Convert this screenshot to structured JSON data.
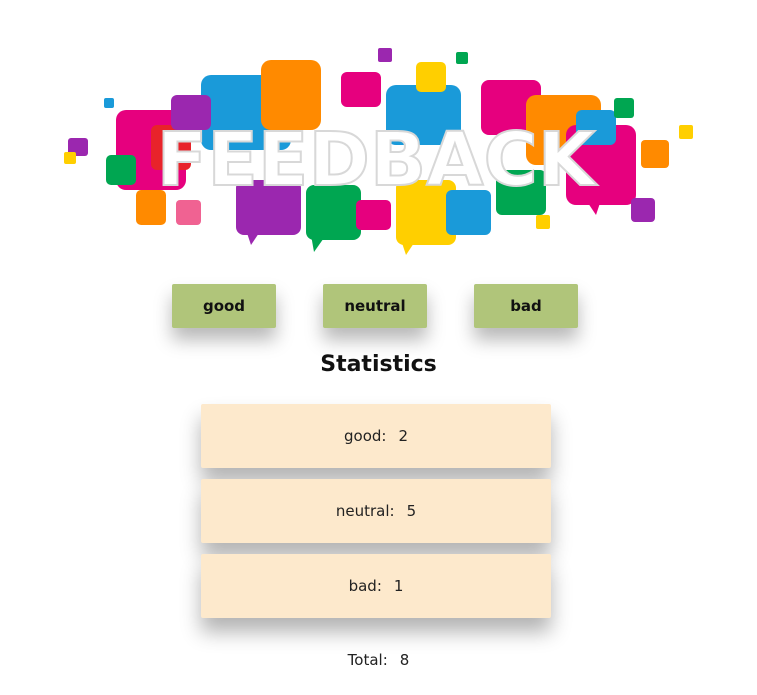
{
  "banner": {
    "text": "FEEDBACK",
    "colors": [
      "#e6007e",
      "#ff8a00",
      "#00a651",
      "#1a9ad9",
      "#ffcf00",
      "#9b27af",
      "#e8232a",
      "#f06292"
    ]
  },
  "buttons": {
    "good": "good",
    "neutral": "neutral",
    "bad": "bad",
    "color": "#b0c57a"
  },
  "statistics": {
    "title": "Statistics",
    "good": {
      "label": "good:",
      "value": "2"
    },
    "neutral": {
      "label": "neutral:",
      "value": "5"
    },
    "bad": {
      "label": "bad:",
      "value": "1"
    },
    "total": {
      "label": "Total:",
      "value": "8"
    },
    "card_color": "#fde9cc"
  }
}
